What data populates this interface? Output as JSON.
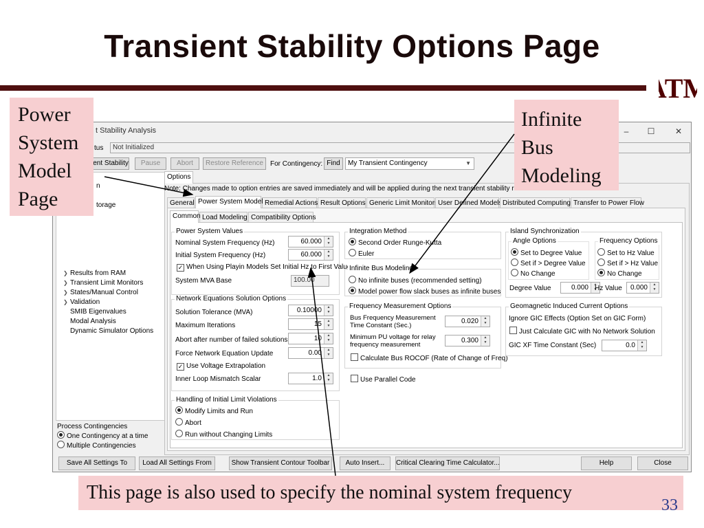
{
  "slide": {
    "title": "Transient Stability Options Page",
    "logo_text": "ATM",
    "page_number": "33"
  },
  "callouts": {
    "left": [
      "Power",
      "System",
      "Model",
      "Page"
    ],
    "right": [
      "Infinite",
      "Bus",
      "Modeling"
    ],
    "bottom": "This page is also used to specify the nominal system frequency"
  },
  "dialog": {
    "title": "t Stability Analysis",
    "status_label": "tus",
    "status_value": "Not Initialized",
    "window_buttons": [
      "–",
      "☐",
      "✕"
    ],
    "toolbar": {
      "run": "ient Stability",
      "pause": "Pause",
      "abort": "Abort",
      "restore": "Restore Reference",
      "for_contingency": "For Contingency:",
      "find": "Find",
      "contingency_value": "My Transient Contingency"
    },
    "tree": {
      "top1": "n",
      "top2": "torage",
      "items": [
        {
          "label": "Results from RAM",
          "arrow": true
        },
        {
          "label": "Transient Limit Monitors",
          "arrow": true
        },
        {
          "label": "States/Manual Control",
          "arrow": true
        },
        {
          "label": "Validation",
          "arrow": true
        },
        {
          "label": "SMIB Eigenvalues",
          "arrow": false
        },
        {
          "label": "Modal Analysis",
          "arrow": false
        },
        {
          "label": "Dynamic Simulator Options",
          "arrow": false
        }
      ]
    },
    "process_contingencies": {
      "title": "Process Contingencies",
      "options": [
        "One Contingency at a time",
        "Multiple Contingencies"
      ],
      "selected": 0
    },
    "options_tab": "Options",
    "note": "Note: Changes made to option entries are saved immediately and will be applied during the next transient stability run.",
    "main_tabs": [
      "General",
      "Power System Model",
      "Remedial Actions",
      "Result Options",
      "Generic Limit Monitors",
      "User Defined Models",
      "Distributed Computing",
      "Transfer to Power Flow"
    ],
    "active_main_tab": 1,
    "sub_tabs": [
      "Common",
      "Load Modeling",
      "Compatibility Options"
    ],
    "active_sub_tab": 0,
    "power_system_values": {
      "title": "Power System Values",
      "nominal_freq_label": "Nominal System Frequency (Hz)",
      "nominal_freq_value": "60.000",
      "initial_freq_label": "Initial System Frequency (Hz)",
      "initial_freq_value": "60.000",
      "playin_label": "When Using Playin Models Set Initial Hz to First Value",
      "playin_checked": true,
      "mva_label": "System MVA Base",
      "mva_value": "100.00"
    },
    "network": {
      "title": "Network Equations Solution Options",
      "tolerance_label": "Solution Tolerance (MVA)",
      "tolerance_value": "0.10000",
      "max_iter_label": "Maximum Iterations",
      "max_iter_value": "15",
      "abort_label": "Abort after number of failed solutions",
      "abort_value": "10",
      "force_label": "Force Network Equation Update",
      "force_value": "0.00",
      "extrap_label": "Use Voltage Extrapolation",
      "extrap_checked": true,
      "inner_label": "Inner Loop Mismatch Scalar",
      "inner_value": "1.0"
    },
    "initial_limits": {
      "title": "Handling of Initial Limit Violations",
      "options": [
        "Modify Limits and Run",
        "Abort",
        "Run without Changing Limits"
      ],
      "selected": 0
    },
    "integration": {
      "title": "Integration Method",
      "options": [
        "Second Order Runge-Kutta",
        "Euler"
      ],
      "selected": 0
    },
    "infinite_bus": {
      "title": "Infinite Bus Modeling",
      "options": [
        "No infinite buses (recommended setting)",
        "Model power flow slack buses as infinite buses"
      ],
      "selected": 1
    },
    "frequency_measurement": {
      "title": "Frequency Measurement Options",
      "bus_freq_label1": "Bus Frequency Measurement",
      "bus_freq_label2": "Time Constant (Sec.)",
      "bus_freq_value": "0.020",
      "min_pu_label1": "Minimum PU voltage for relay",
      "min_pu_label2": "frequency measurement",
      "min_pu_value": "0.300",
      "rocof_label": "Calculate Bus ROCOF (Rate of Change of Freq)",
      "rocof_checked": false
    },
    "parallel": {
      "label": "Use Parallel Code",
      "checked": false
    },
    "island_sync": {
      "title": "Island Synchronization",
      "angle": {
        "title": "Angle Options",
        "options": [
          "Set to Degree Value",
          "Set if > Degree Value",
          "No Change"
        ],
        "selected": 0
      },
      "frequency": {
        "title": "Frequency Options",
        "options": [
          "Set to Hz Value",
          "Set if > Hz Value",
          "No Change"
        ],
        "selected": 2
      },
      "degree_label": "Degree Value",
      "degree_value": "0.000",
      "hz_label": "Hz Value",
      "hz_value": "0.000"
    },
    "gic": {
      "title": "Geomagnetic Induced Current Options",
      "ignore_label": "Ignore GIC Effects (Option Set on GIC Form)",
      "just_calc_label": "Just Calculate GIC with No Network Solution",
      "just_calc_checked": false,
      "xf_label": "GIC XF Time Constant (Sec)",
      "xf_value": "0.0"
    },
    "bottom_buttons": {
      "save_all": "Save All Settings To",
      "load_all": "Load All Settings From",
      "contour": "Show Transient Contour Toolbar",
      "auto_insert": "Auto Insert...",
      "cct": "Critical Clearing Time Calculator...",
      "help": "Help",
      "close": "Close"
    }
  },
  "colors": {
    "title_rule": "#4f0f0f",
    "callout_bg": "#f7cfd1",
    "page_number": "#2b3a8c",
    "dialog_bg": "#f0f0f0"
  }
}
